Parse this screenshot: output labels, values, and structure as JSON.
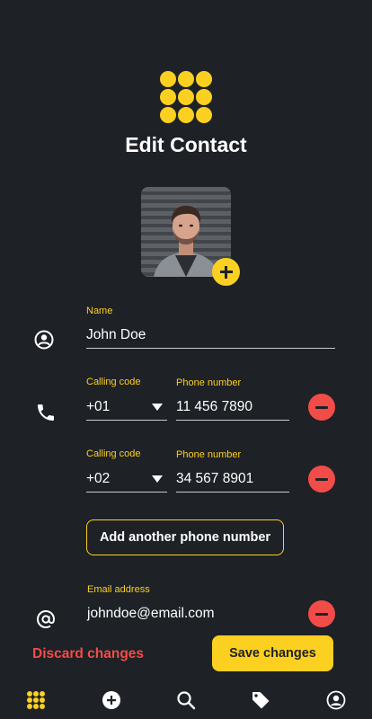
{
  "header": {
    "title": "Edit Contact"
  },
  "form": {
    "name": {
      "label": "Name",
      "value": "John Doe"
    },
    "phones": [
      {
        "code_label": "Calling code",
        "code": "+01",
        "number_label": "Phone number",
        "number": "11 456 7890"
      },
      {
        "code_label": "Calling code",
        "code": "+02",
        "number_label": "Phone number",
        "number": "34 567 8901"
      }
    ],
    "add_phone_label": "Add another phone number",
    "email": {
      "label": "Email address",
      "value": "johndoe@email.com"
    }
  },
  "actions": {
    "discard_label": "Discard changes",
    "save_label": "Save changes"
  },
  "nav": [
    "grid-logo-icon",
    "add-circle-icon",
    "search-icon",
    "tag-icon",
    "profile-icon"
  ],
  "colors": {
    "background": "#1e2126",
    "accent": "#fcd021",
    "danger": "#f24c48",
    "text": "#ffffff"
  }
}
